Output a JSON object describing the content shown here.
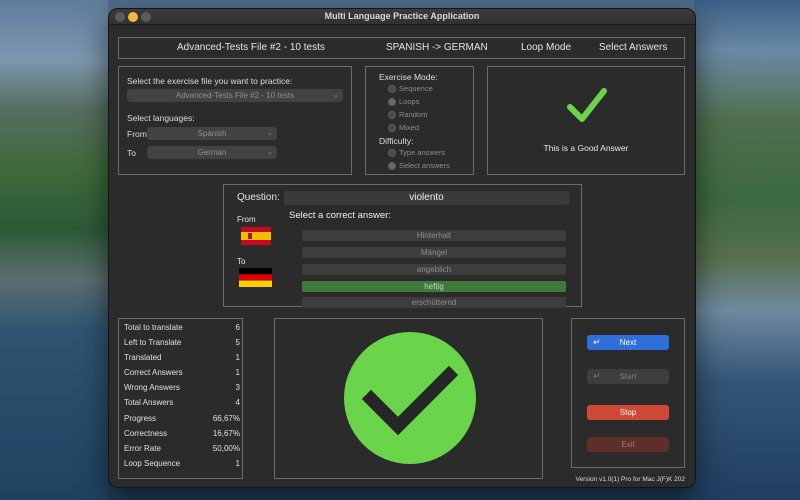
{
  "window": {
    "title": "Multi Language Practice Application"
  },
  "header": {
    "file": "Advanced-Tests File #2 - 10 tests",
    "direction": "SPANISH -> GERMAN",
    "loop_mode": "Loop Mode",
    "select_answers": "Select Answers"
  },
  "file_panel": {
    "select_file_label": "Select the exercise file you want to practice:",
    "file_value": "Advanced-Tests File #2 - 10 tests",
    "select_languages_label": "Select languages:",
    "from_label": "From",
    "from_value": "Spanish",
    "to_label": "To",
    "to_value": "German"
  },
  "mode_panel": {
    "exercise_mode_label": "Exercise Mode:",
    "modes": [
      "Sequence",
      "Loops",
      "Random",
      "Mixed"
    ],
    "selected_mode": "Loops",
    "difficulty_label": "Difficulty:",
    "difficulties": [
      "Type answers",
      "Select answers"
    ],
    "selected_difficulty": "Select answers"
  },
  "feedback_panel": {
    "icon": "checkmark-icon",
    "message": "This is a Good Answer",
    "color": "#6cd34b"
  },
  "question_panel": {
    "question_label": "Question:",
    "question_word": "violento",
    "from_label": "From",
    "to_label": "To",
    "select_prompt": "Select a correct answer:",
    "answers": [
      "Hinterhalt",
      "Mängel",
      "angeblich",
      "heftig",
      "erschütternd"
    ],
    "correct_answer": "heftig"
  },
  "stats": [
    {
      "label": "Total to translate",
      "value": "6"
    },
    {
      "label": "Left to Translate",
      "value": "5"
    },
    {
      "label": "Translated",
      "value": "1"
    },
    {
      "label": "Correct Answers",
      "value": "1"
    },
    {
      "label": "Wrong Answers",
      "value": "3"
    },
    {
      "label": "Total Answers",
      "value": "4"
    },
    {
      "label": "Progress",
      "value": "66,67%"
    },
    {
      "label": "Correctness",
      "value": "16,67%"
    },
    {
      "label": "Error Rate",
      "value": "50,00%"
    },
    {
      "label": "Loop Sequence",
      "value": "1"
    }
  ],
  "result": {
    "icon": "big-checkmark-icon",
    "circle_color": "#6ad54a"
  },
  "buttons": {
    "next": "Next",
    "start": "Start",
    "stop": "Stop",
    "exit": "Exit"
  },
  "colors": {
    "accent_blue": "#2f6fd9",
    "stop_red": "#cf4a36",
    "correct_green": "#3f7a3a"
  },
  "version": "Version v1.0(1) Pro for Mac J(F)K 202"
}
